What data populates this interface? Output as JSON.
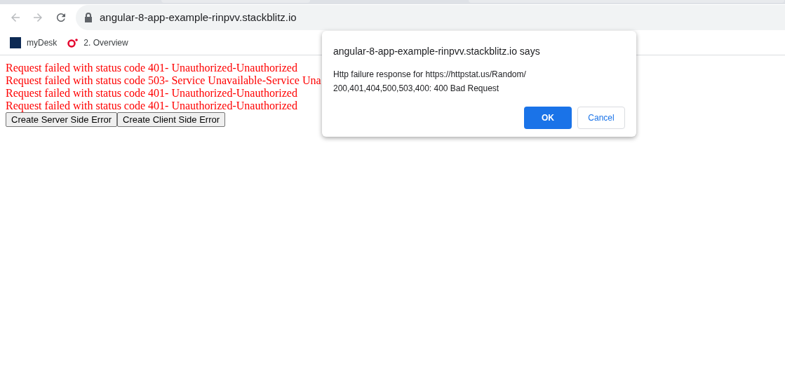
{
  "browser": {
    "address": "angular-8-app-example-rinpvv.stackblitz.io",
    "bookmarks": [
      {
        "label": "myDesk"
      },
      {
        "label": "2. Overview"
      }
    ]
  },
  "page": {
    "errors": [
      "Request failed with status code 401- Unauthorized-Unauthorized",
      "Request failed with status code 503- Service Unavailable-Service Una",
      "Request failed with status code 401- Unauthorized-Unauthorized",
      "Request failed with status code 401- Unauthorized-Unauthorized"
    ],
    "buttons": [
      "Create Server Side Error",
      "Create Client Side Error"
    ]
  },
  "dialog": {
    "title": "angular-8-app-example-rinpvv.stackblitz.io says",
    "message_lines": [
      "Http failure response for https://httpstat.us/Random/",
      "200,401,404,500,503,400: 400 Bad Request"
    ],
    "ok": "OK",
    "cancel": "Cancel"
  }
}
